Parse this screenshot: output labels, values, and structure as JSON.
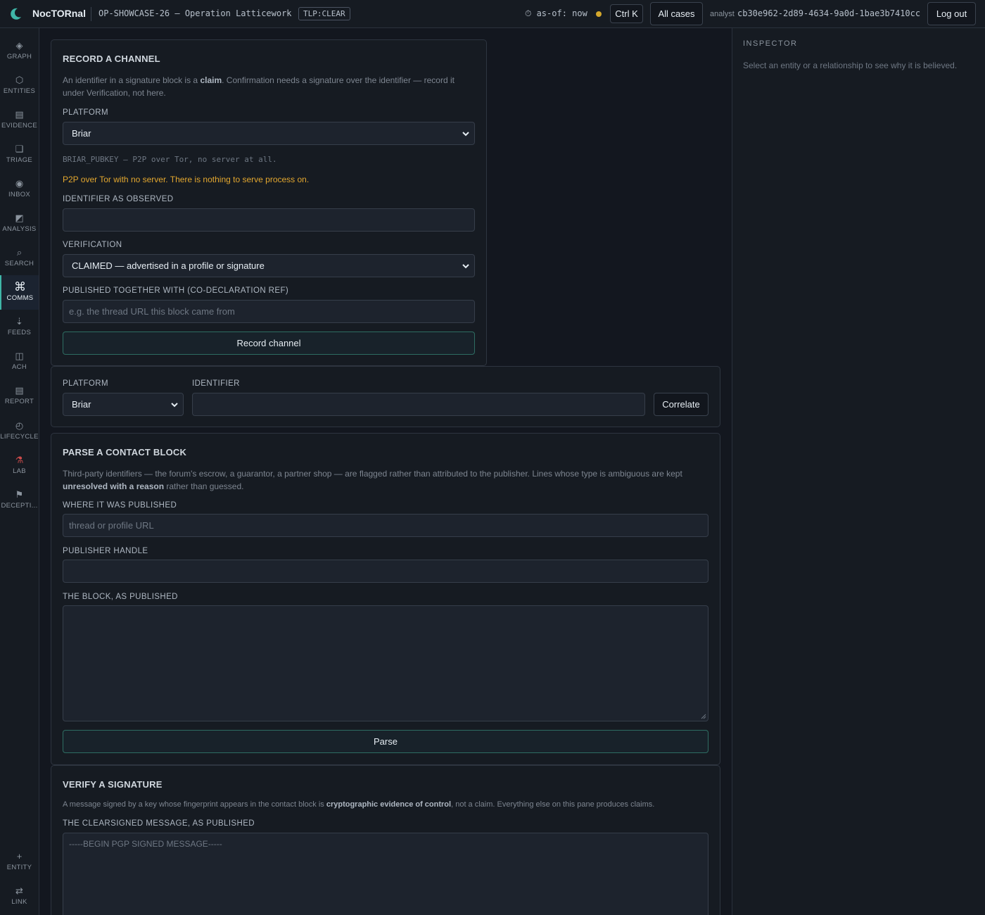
{
  "topbar": {
    "app_name": "NocTORnal",
    "case_title": "OP-SHOWCASE-26 — Operation Latticework",
    "tlp": "TLP:CLEAR",
    "asof": "⏱ as-of: now",
    "shortcut": "Ctrl K",
    "all_cases": "All cases",
    "analyst_label": "analyst",
    "analyst_id": "cb30e962-2d89-4634-9a0d-1bae3b7410cc",
    "logout": "Log out",
    "status_color": "#d4a72c"
  },
  "nav": {
    "items": [
      {
        "label": "GRAPH",
        "icon": "◈"
      },
      {
        "label": "ENTITIES",
        "icon": "⬡"
      },
      {
        "label": "EVIDENCE",
        "icon": "▤"
      },
      {
        "label": "TRIAGE",
        "icon": "❑"
      },
      {
        "label": "INBOX",
        "icon": "◉"
      },
      {
        "label": "ANALYSIS",
        "icon": "◩"
      },
      {
        "label": "SEARCH",
        "icon": "⌕"
      },
      {
        "label": "COMMS",
        "icon": "⌘"
      },
      {
        "label": "FEEDS",
        "icon": "⇣"
      },
      {
        "label": "ACH",
        "icon": "◫"
      },
      {
        "label": "REPORT",
        "icon": "▤"
      },
      {
        "label": "LIFECYCLE",
        "icon": "◴"
      },
      {
        "label": "LAB",
        "icon": "⚗"
      },
      {
        "label": "DECEPTI...",
        "icon": "⚑"
      }
    ],
    "active": "COMMS",
    "bottom": [
      {
        "label": "ENTITY",
        "icon": "+"
      },
      {
        "label": "LINK",
        "icon": "⇄"
      }
    ]
  },
  "inspector": {
    "title": "INSPECTOR",
    "hint": "Select an entity or a relationship to see why it is believed."
  },
  "record": {
    "title": "RECORD A CHANNEL",
    "desc_1": "An identifier in a signature block is a ",
    "desc_bold": "claim",
    "desc_2": ". Confirmation needs a signature over the identifier — record it",
    "desc_3": "under Verification, not here.",
    "platform_label": "PLATFORM",
    "platform_value": "Briar",
    "platform_hint": "BRIAR_PUBKEY — P2P over Tor, no server at all.",
    "warning": "P2P over Tor with no server. There is nothing to serve process on.",
    "identifier_label": "IDENTIFIER AS OBSERVED",
    "identifier_value": "",
    "verification_label": "VERIFICATION",
    "verification_value": "CLAIMED — advertised in a profile or signature",
    "codecl_label": "PUBLISHED TOGETHER WITH (CO-DECLARATION REF)",
    "codecl_placeholder": "e.g. the thread URL this block came from",
    "button": "Record channel"
  },
  "correlate": {
    "platform_label": "PLATFORM",
    "platform_value": "Briar",
    "identifier_label": "IDENTIFIER",
    "identifier_value": "",
    "button": "Correlate"
  },
  "parse": {
    "title": "PARSE A CONTACT BLOCK",
    "desc_1": "Third-party identifiers — the forum's escrow, a guarantor, a partner shop — are flagged rather than attributed to the publisher. Lines whose type is ambiguous are kept",
    "desc_bold": "unresolved with a reason",
    "desc_2": " rather than guessed.",
    "where_label": "WHERE IT WAS PUBLISHED",
    "where_placeholder": "thread or profile URL",
    "handle_label": "PUBLISHER HANDLE",
    "handle_value": "",
    "block_label": "THE BLOCK, AS PUBLISHED",
    "block_value": "",
    "button": "Parse"
  },
  "verify": {
    "title": "VERIFY A SIGNATURE",
    "desc_1": "A message signed by a key whose fingerprint appears in the contact block is ",
    "desc_bold": "cryptographic evidence of control",
    "desc_2": ", not a claim. Everything else on this pane produces claims.",
    "msg_label": "THE CLEARSIGNED MESSAGE, AS PUBLISHED",
    "msg_placeholder": "-----BEGIN PGP SIGNED MESSAGE-----"
  }
}
